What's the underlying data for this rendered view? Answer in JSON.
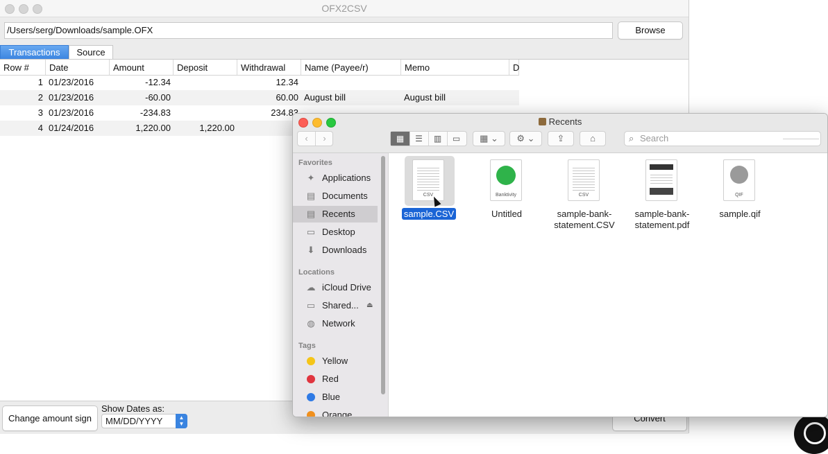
{
  "main_window": {
    "title": "OFX2CSV",
    "file_path": "/Users/serg/Downloads/sample.OFX",
    "browse_label": "Browse",
    "tabs": [
      {
        "label": "Transactions",
        "active": true
      },
      {
        "label": "Source",
        "active": false
      }
    ],
    "columns": [
      "Row #",
      "Date",
      "Amount",
      "Deposit",
      "Withdrawal",
      "Name (Payee/r)",
      "Memo",
      "D"
    ],
    "rows": [
      {
        "row": "1",
        "date": "01/23/2016",
        "amount": "-12.34",
        "deposit": "",
        "withdrawal": "12.34",
        "name": "",
        "memo": ""
      },
      {
        "row": "2",
        "date": "01/23/2016",
        "amount": "-60.00",
        "deposit": "",
        "withdrawal": "60.00",
        "name": "August bill",
        "memo": "August bill"
      },
      {
        "row": "3",
        "date": "01/23/2016",
        "amount": "-234.83",
        "deposit": "",
        "withdrawal": "234.83",
        "name": "",
        "memo": ""
      },
      {
        "row": "4",
        "date": "01/24/2016",
        "amount": "1,220.00",
        "deposit": "1,220.00",
        "withdrawal": "",
        "name": "",
        "memo": ""
      }
    ],
    "change_sign_label": "Change amount sign",
    "show_dates_label": "Show Dates as:",
    "date_format": "MM/DD/YYYY",
    "convert_label": "Convert"
  },
  "finder": {
    "title": "Recents",
    "search_placeholder": "Search",
    "sidebar": {
      "favorites_header": "Favorites",
      "favorites": [
        {
          "label": "Applications",
          "icon": "applications-icon"
        },
        {
          "label": "Documents",
          "icon": "documents-icon"
        },
        {
          "label": "Recents",
          "icon": "recents-icon",
          "selected": true
        },
        {
          "label": "Desktop",
          "icon": "desktop-icon"
        },
        {
          "label": "Downloads",
          "icon": "downloads-icon"
        }
      ],
      "locations_header": "Locations",
      "locations": [
        {
          "label": "iCloud Drive",
          "icon": "cloud-icon"
        },
        {
          "label": "Shared...",
          "icon": "display-icon"
        },
        {
          "label": "Network",
          "icon": "globe-icon"
        }
      ],
      "tags_header": "Tags",
      "tags": [
        {
          "label": "Yellow",
          "color": "#f5c518"
        },
        {
          "label": "Red",
          "color": "#e0353f"
        },
        {
          "label": "Blue",
          "color": "#2f7ae5"
        },
        {
          "label": "Orange",
          "color": "#f0901e"
        }
      ]
    },
    "files": [
      {
        "name": "sample.CSV",
        "badge": "CSV",
        "selected": true
      },
      {
        "name": "Untitled",
        "badge": "Banktivity"
      },
      {
        "name": "sample-bank-statement.CSV",
        "line1": "sample-bank-",
        "line2": "statement.CSV",
        "badge": "CSV"
      },
      {
        "name": "sample-bank-statement.pdf",
        "line1": "sample-bank-",
        "line2": "statement.pdf",
        "badge": ""
      },
      {
        "name": "sample.qif",
        "badge": "QIF"
      }
    ]
  }
}
